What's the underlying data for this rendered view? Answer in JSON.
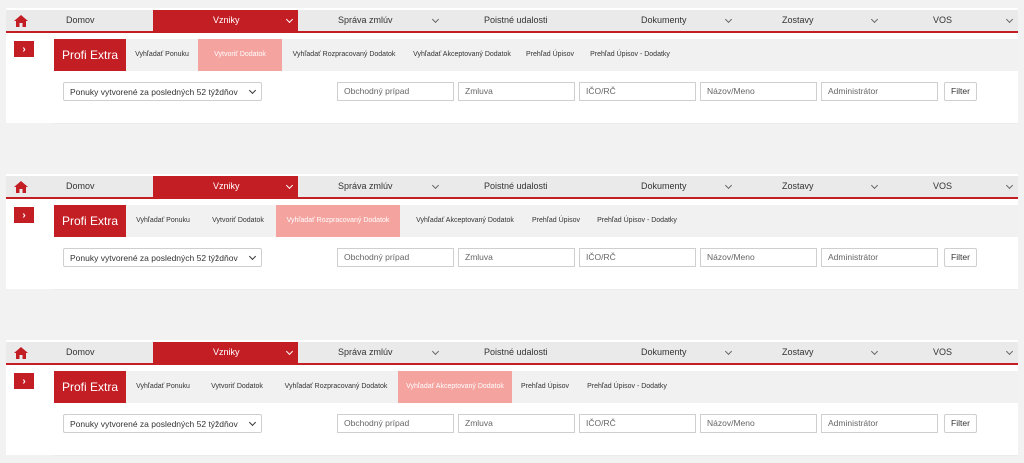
{
  "nav": {
    "home_icon": "home-icon",
    "items": [
      {
        "label": "Domov",
        "has_dropdown": false
      },
      {
        "label": "Vzniky",
        "has_dropdown": true,
        "active": true
      },
      {
        "label": "Správa zmlúv",
        "has_dropdown": true
      },
      {
        "label": "Poistné udalosti",
        "has_dropdown": false
      },
      {
        "label": "Dokumenty",
        "has_dropdown": true
      },
      {
        "label": "Zostavy",
        "has_dropdown": true
      },
      {
        "label": "VOS",
        "has_dropdown": true
      }
    ]
  },
  "brand": "Profi Extra",
  "tabs": [
    {
      "label": "Vyhľadať Ponuku"
    },
    {
      "label": "Vytvoriť Dodatok"
    },
    {
      "label": "Vyhľadať Rozpracovaný Dodatok"
    },
    {
      "label": "Vyhľadať Akceptovaný Dodatok"
    },
    {
      "label": "Prehľad Úpisov"
    },
    {
      "label": "Prehľad Úpisov - Dodatky"
    }
  ],
  "filters": {
    "period_select": "Ponuky vytvorené za posledných 52 týždňov",
    "placeholders": [
      "Obchodný prípad",
      "Zmluva",
      "IČO/RČ",
      "Názov/Meno",
      "Administrátor"
    ],
    "filter_button": "Filter"
  },
  "panels": [
    {
      "active_tab": 1
    },
    {
      "active_tab": 2
    },
    {
      "active_tab": 3
    }
  ],
  "colors": {
    "accent": "#c41e25",
    "active_tab": "#f4a39f",
    "background": "#f2f2f2"
  }
}
